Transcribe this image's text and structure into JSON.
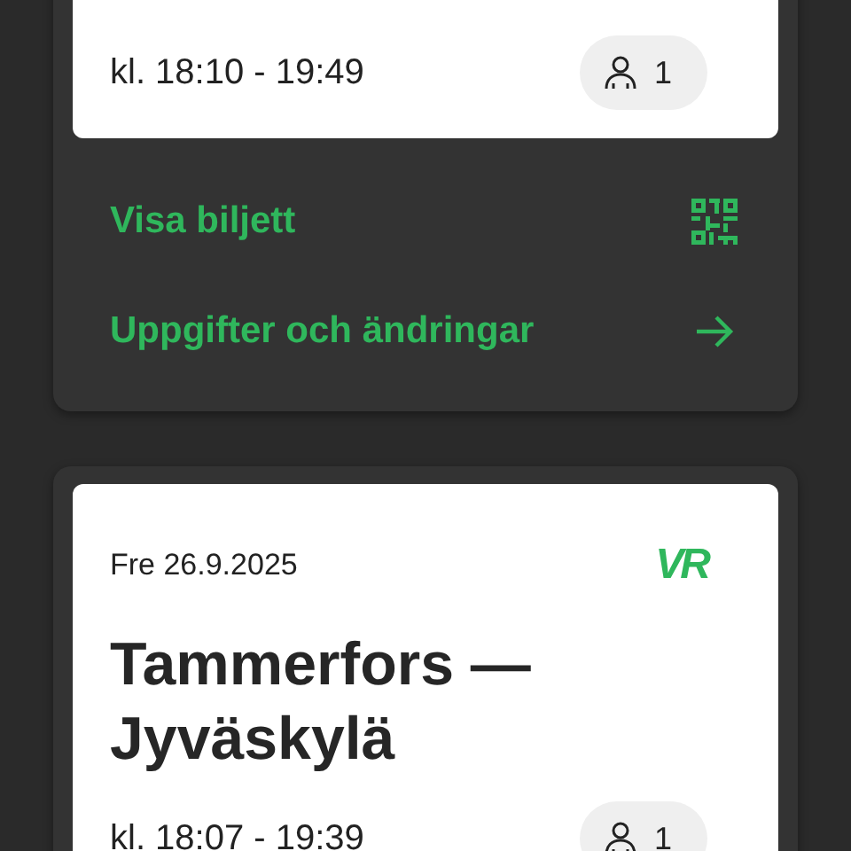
{
  "trips": [
    {
      "time": "kl. 18:10 - 19:49",
      "passengers": "1",
      "actions": [
        {
          "label": "Visa biljett",
          "kind": "qr"
        },
        {
          "label": "Uppgifter och ändringar",
          "kind": "arrow"
        }
      ]
    },
    {
      "date": "Fre 26.9.2025",
      "logo": "VR",
      "title": "Tammerfors — Jyväskylä",
      "time": "kl. 18:07 - 19:39",
      "passengers": "1"
    }
  ]
}
